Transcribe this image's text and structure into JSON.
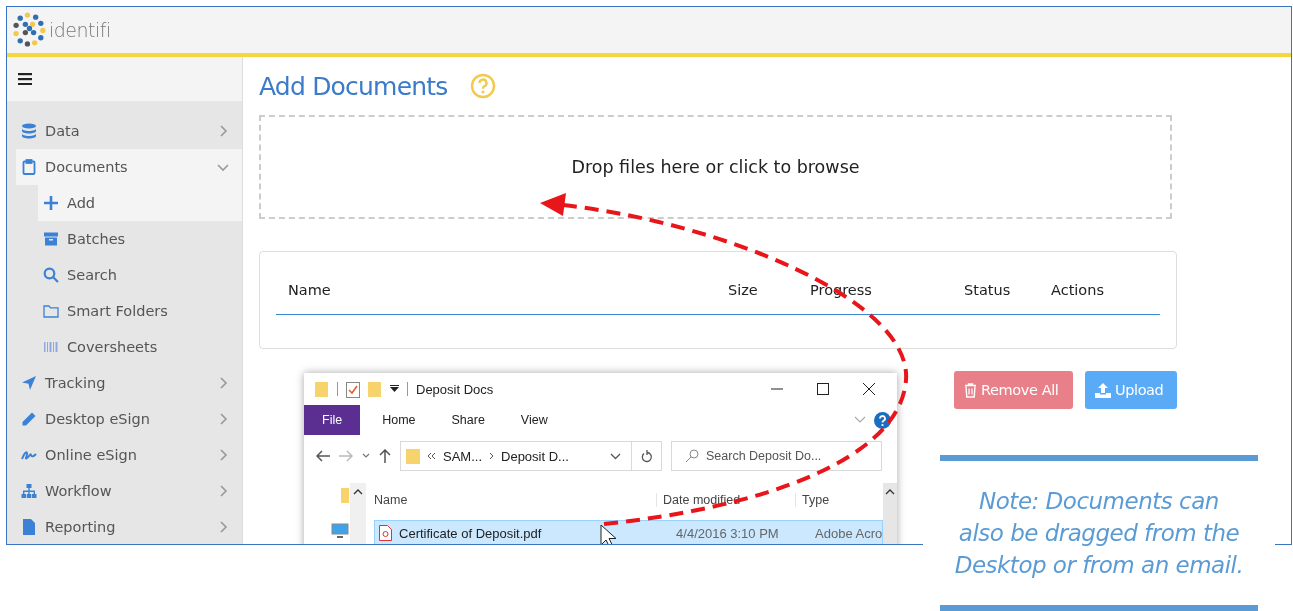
{
  "header": {
    "logo_text": "identifi"
  },
  "sidebar": {
    "items": [
      {
        "label": "Data",
        "expanded": false,
        "selected": false
      },
      {
        "label": "Documents",
        "expanded": true,
        "selected": true,
        "children": [
          {
            "label": "Add",
            "selected": true
          },
          {
            "label": "Batches",
            "selected": false
          },
          {
            "label": "Search",
            "selected": false
          },
          {
            "label": "Smart Folders",
            "selected": false
          },
          {
            "label": "Coversheets",
            "selected": false
          }
        ]
      },
      {
        "label": "Tracking",
        "expanded": false,
        "selected": false
      },
      {
        "label": "Desktop eSign",
        "expanded": false,
        "selected": false
      },
      {
        "label": "Online eSign",
        "expanded": false,
        "selected": false
      },
      {
        "label": "Workflow",
        "expanded": false,
        "selected": false
      },
      {
        "label": "Reporting",
        "expanded": false,
        "selected": false
      }
    ]
  },
  "page": {
    "title": "Add Documents",
    "dropzone": "Drop files here or click to browse",
    "table": {
      "columns": [
        "Name",
        "Size",
        "Progress",
        "Status",
        "Actions"
      ]
    },
    "buttons": [
      {
        "label": "Remove All",
        "kind": "danger"
      },
      {
        "label": "Upload",
        "kind": "primary"
      }
    ]
  },
  "explorer": {
    "title": "Deposit Docs",
    "tabs": [
      {
        "label": "File",
        "selected": true
      },
      {
        "label": "Home",
        "selected": false
      },
      {
        "label": "Share",
        "selected": false
      },
      {
        "label": "View",
        "selected": false
      }
    ],
    "path": [
      "SAM...",
      "Deposit D..."
    ],
    "search": {
      "placeholder": "Search Deposit Do..."
    },
    "columns": [
      "Name",
      "Date modified",
      "Type"
    ],
    "rows": [
      {
        "name": "Certificate of Deposit.pdf",
        "date": "4/4/2016 3:10 PM",
        "type": "Adobe Acro",
        "selected": true
      }
    ]
  },
  "note": {
    "lines": [
      "Note:  Documents can",
      "also be dragged from the",
      "Desktop or from an email."
    ]
  }
}
